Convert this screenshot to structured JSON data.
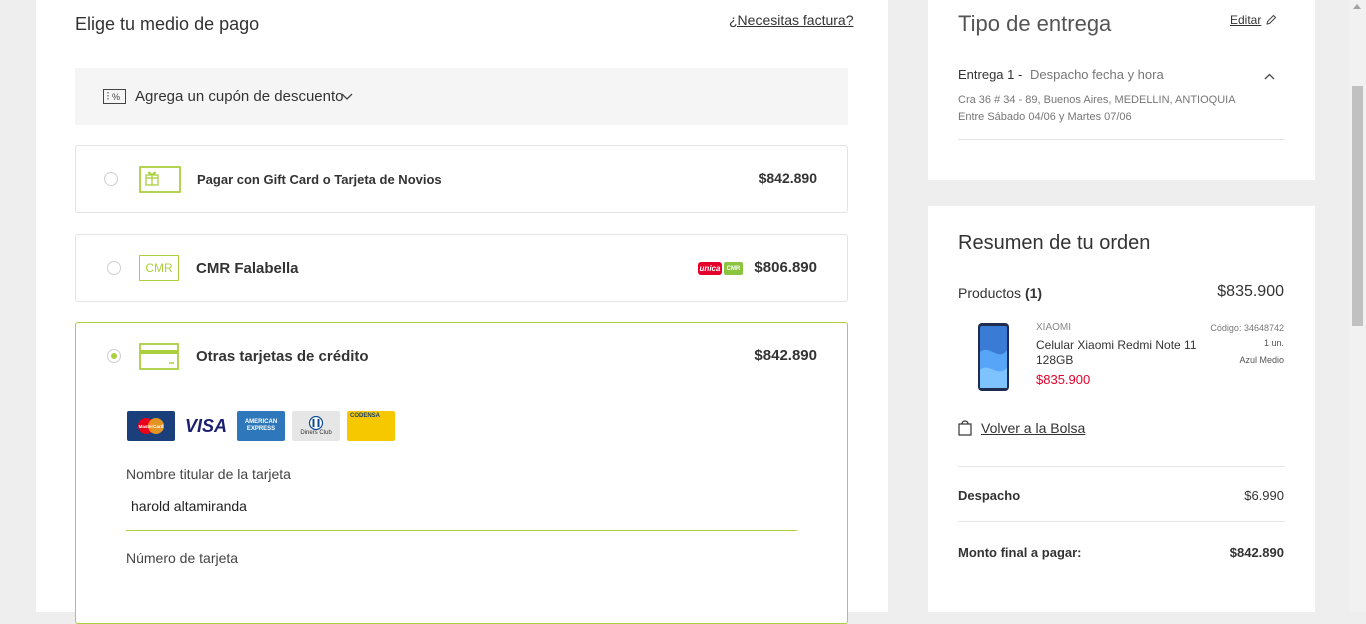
{
  "payment": {
    "title": "Elige tu medio de pago",
    "invoice_link": "¿Necesitas factura?",
    "coupon": {
      "label": "Agrega un cupón de descuento",
      "icon": "coupon-percent-icon"
    },
    "methods": [
      {
        "label": "Pagar con Gift Card o Tarjeta de Novios",
        "price": "$842.890",
        "selected": false,
        "icon": "gift-card-icon"
      },
      {
        "label": "CMR Falabella",
        "price": "$806.890",
        "selected": false,
        "icon": "cmr-card-icon",
        "icon_text": "CMR",
        "badges": [
          "unica",
          "CMR"
        ]
      },
      {
        "label": "Otras tarjetas de crédito",
        "price": "$842.890",
        "selected": true,
        "icon": "credit-card-icon"
      }
    ],
    "brands": [
      "MasterCard",
      "VISA",
      "AMERICAN EXPRESS",
      "Diners Club",
      "CODENSA"
    ],
    "cardholder": {
      "label": "Nombre titular de la tarjeta",
      "value": "harold altamiranda"
    },
    "card_number": {
      "label": "Número de tarjeta",
      "value": ""
    }
  },
  "delivery": {
    "title": "Tipo de entrega",
    "edit_label": "Editar",
    "entry_label": "Entrega 1 -",
    "entry_type": "Despacho fecha y hora",
    "address": "Cra 36 # 34 - 89, Buenos Aires, MEDELLIN, ANTIOQUIA",
    "window": "Entre Sábado 04/06 y Martes 07/06"
  },
  "summary": {
    "title": "Resumen de tu orden",
    "products_label": "Productos",
    "products_count": "(1)",
    "products_total": "$835.900",
    "item": {
      "brand": "XIAOMI",
      "name": "Celular Xiaomi Redmi Note 11 128GB",
      "price": "$835.900",
      "code": "Código: 34648742",
      "qty": "1 un.",
      "color": "Azul Medio"
    },
    "back_link": "Volver a la Bolsa",
    "shipping_label": "Despacho",
    "shipping_value": "$6.990",
    "final_label": "Monto final a pagar:",
    "final_value": "$842.890"
  },
  "colors": {
    "accent": "#aad03d",
    "price_red": "#e4002b",
    "unica_red": "#e4002b",
    "cmr_green": "#8bc53f"
  }
}
